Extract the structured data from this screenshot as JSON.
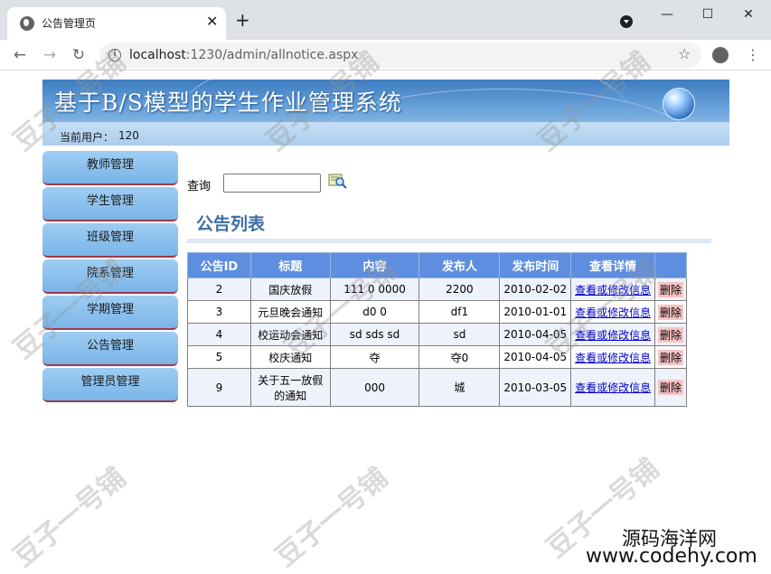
{
  "browser": {
    "tab_title": "公告管理页",
    "url_host": "localhost",
    "url_path": ":1230/admin/allnotice.aspx"
  },
  "banner": {
    "title": "基于B/S模型的学生作业管理系统",
    "user_label": "当前用户：",
    "user_value": "120"
  },
  "sidebar": {
    "items": [
      {
        "label": "教师管理"
      },
      {
        "label": "学生管理"
      },
      {
        "label": "班级管理"
      },
      {
        "label": "院系管理"
      },
      {
        "label": "学期管理"
      },
      {
        "label": "公告管理"
      },
      {
        "label": "管理员管理"
      }
    ]
  },
  "search": {
    "label": "查询",
    "value": ""
  },
  "list": {
    "title": "公告列表",
    "columns": [
      "公告ID",
      "标题",
      "内容",
      "发布人",
      "发布时间",
      "查看详情",
      ""
    ],
    "rows": [
      {
        "id": "2",
        "title": "国庆放假",
        "content": "111 0 0000",
        "author": "2200",
        "date": "2010-02-02",
        "detail": "查看或修改信息",
        "delete": "删除"
      },
      {
        "id": "3",
        "title": "元旦晚会通知",
        "content": "d0 0",
        "author": "df1",
        "date": "2010-01-01",
        "detail": "查看或修改信息",
        "delete": "删除"
      },
      {
        "id": "4",
        "title": "校运动会通知",
        "content": "sd sds sd",
        "author": "sd",
        "date": "2010-04-05",
        "detail": "查看或修改信息",
        "delete": "删除"
      },
      {
        "id": "5",
        "title": "校庆通知",
        "content": "夺",
        "author": "夺0",
        "date": "2010-04-05",
        "detail": "查看或修改信息",
        "delete": "删除"
      },
      {
        "id": "9",
        "title": "关于五一放假的通知",
        "content": "000",
        "author": "城",
        "date": "2010-03-05",
        "detail": "查看或修改信息",
        "delete": "删除"
      }
    ]
  },
  "watermark": {
    "text": "豆子一号铺",
    "site_cn": "源码海洋网",
    "site_url": "www.codehy.com"
  }
}
